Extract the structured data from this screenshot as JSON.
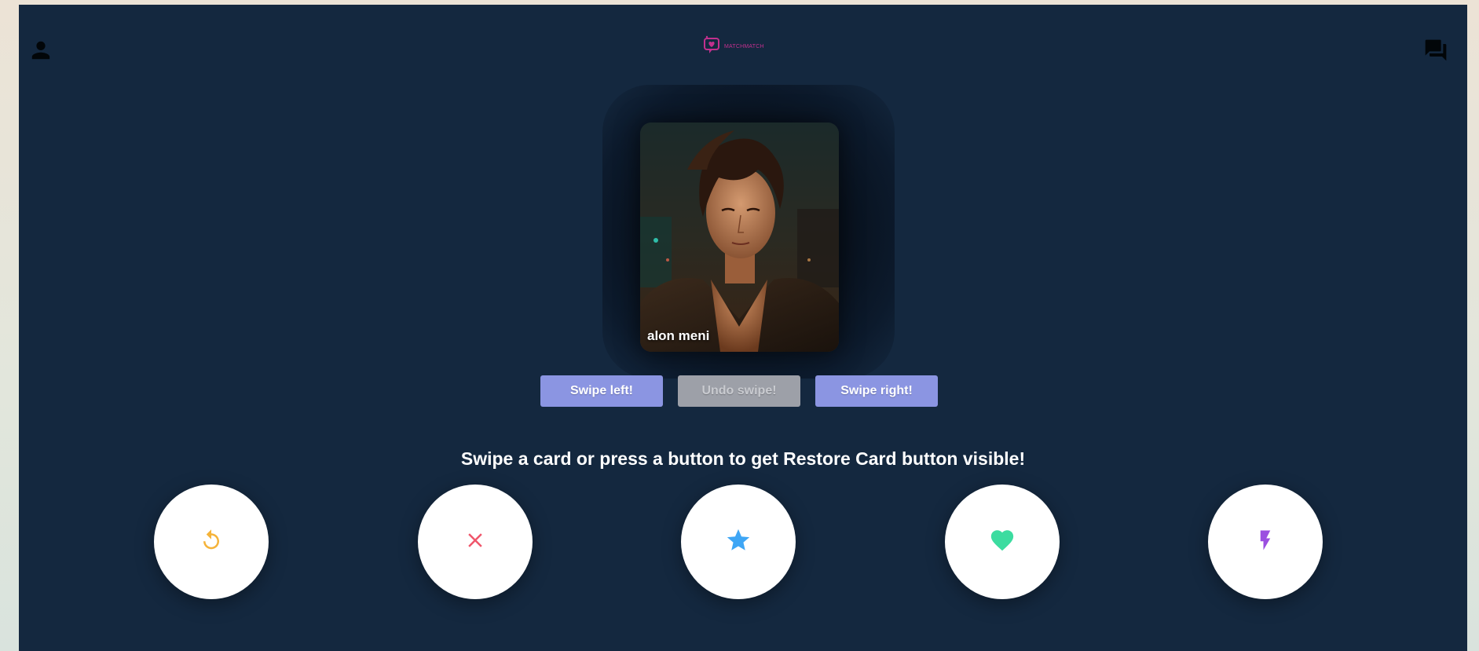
{
  "header": {
    "logo_text": "MATCHMATCH",
    "icons": {
      "profile": "person-icon",
      "logo": "chat-heart-logo-icon",
      "chats": "forum-icon"
    }
  },
  "card": {
    "name": "alon meni"
  },
  "swipe_buttons": {
    "left_label": "Swipe left!",
    "undo_label": "Undo swipe!",
    "right_label": "Swipe right!"
  },
  "hint_text": "Swipe a card or press a button to get Restore Card button visible!",
  "action_buttons": [
    {
      "icon": "replay-icon",
      "color": "#f5b339"
    },
    {
      "icon": "close-icon",
      "color": "#f0566b"
    },
    {
      "icon": "star-icon",
      "color": "#3ea6f5"
    },
    {
      "icon": "heart-icon",
      "color": "#3cdca0"
    },
    {
      "icon": "flash-icon",
      "color": "#9b4fe0"
    }
  ],
  "colors": {
    "background": "#14283f",
    "button_primary": "#8b95e2",
    "button_disabled": "#9da0a8",
    "logo": "#c2308e"
  }
}
